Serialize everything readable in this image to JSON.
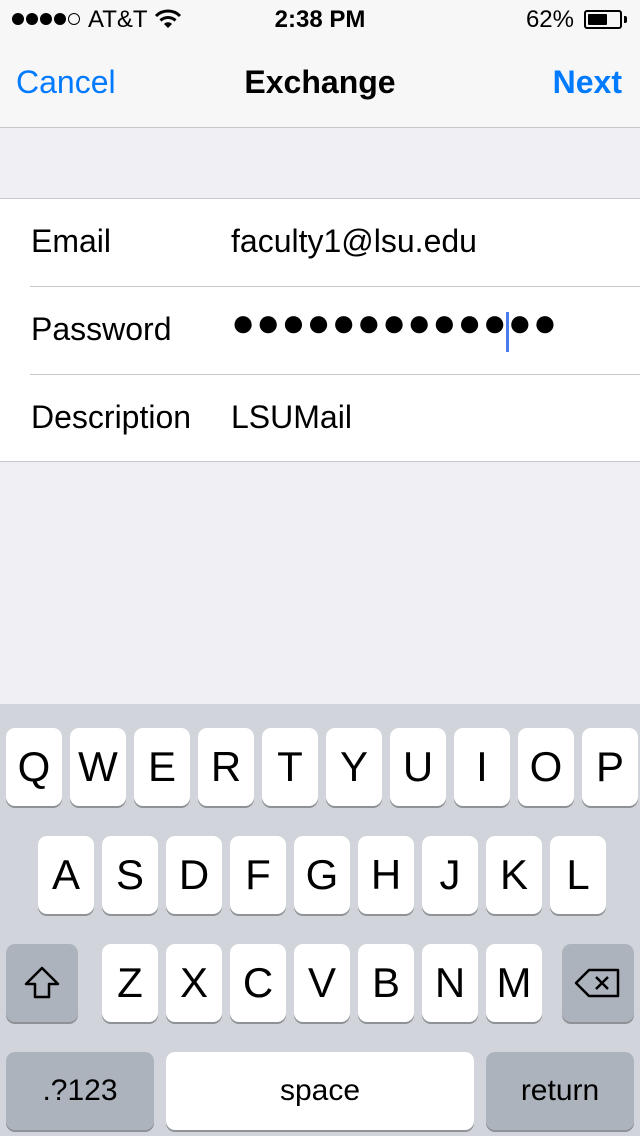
{
  "status_bar": {
    "carrier": "AT&T",
    "time": "2:38 PM",
    "battery_percent": "62%",
    "battery_level": 0.62,
    "signal_bars": 4
  },
  "nav": {
    "cancel_label": "Cancel",
    "title": "Exchange",
    "next_label": "Next"
  },
  "form": {
    "email_label": "Email",
    "email_value": "faculty1@lsu.edu",
    "password_label": "Password",
    "password_value": "●●●●●●●●●●●●●",
    "description_label": "Description",
    "description_value": "LSUMail"
  },
  "keyboard": {
    "row1": [
      "Q",
      "W",
      "E",
      "R",
      "T",
      "Y",
      "U",
      "I",
      "O",
      "P"
    ],
    "row2": [
      "A",
      "S",
      "D",
      "F",
      "G",
      "H",
      "J",
      "K",
      "L"
    ],
    "row3": [
      "Z",
      "X",
      "C",
      "V",
      "B",
      "N",
      "M"
    ],
    "numbers_label": ".?123",
    "space_label": "space",
    "return_label": "return",
    "shift_icon": "shift-icon",
    "delete_icon": "delete-icon"
  },
  "colors": {
    "accent": "#007aff",
    "cursor": "#4b7bec"
  }
}
